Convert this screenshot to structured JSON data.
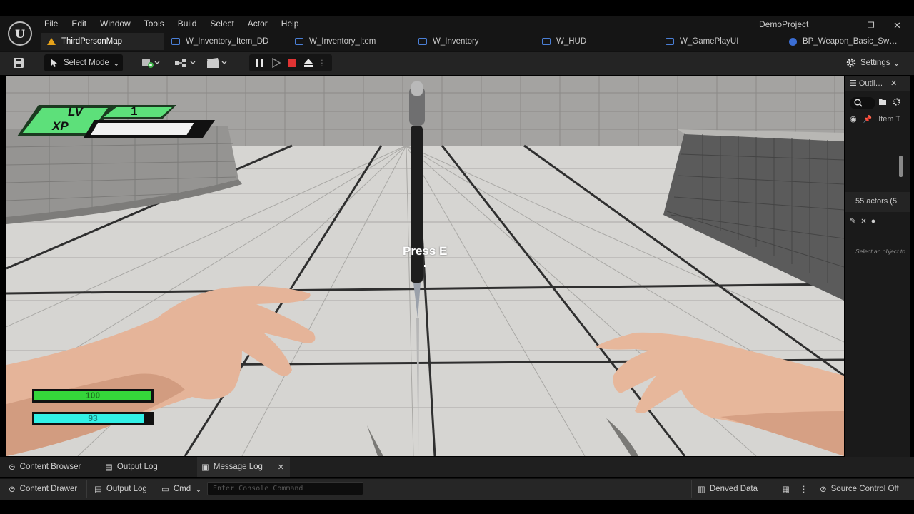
{
  "menu": [
    "File",
    "Edit",
    "Window",
    "Tools",
    "Build",
    "Select",
    "Actor",
    "Help"
  ],
  "project_name": "DemoProject",
  "window_controls": {
    "minimize": "–",
    "restore": "❐",
    "close": "✕"
  },
  "tabs": [
    {
      "label": "ThirdPersonMap",
      "icon": "map-warning-icon"
    },
    {
      "label": "W_Inventory_Item_DD",
      "icon": "widget-blueprint-icon"
    },
    {
      "label": "W_Inventory_Item",
      "icon": "widget-blueprint-icon"
    },
    {
      "label": "W_Inventory",
      "icon": "widget-blueprint-icon"
    },
    {
      "label": "W_HUD",
      "icon": "widget-blueprint-icon"
    },
    {
      "label": "W_GamePlayUI",
      "icon": "widget-blueprint-icon"
    },
    {
      "label": "BP_Weapon_Basic_Sw…",
      "icon": "blueprint-icon"
    }
  ],
  "toolbar": {
    "select_mode": "Select Mode",
    "settings": "Settings"
  },
  "hud": {
    "lv_label": "LV",
    "lv_value": "1",
    "xp_label": "XP",
    "xp_progress": 0.82,
    "health_value": "100",
    "health_progress": 1.0,
    "stamina_value": "93",
    "stamina_progress": 0.93,
    "prompt": "Press E"
  },
  "outliner": {
    "title": "Outli…",
    "item": "Item T",
    "actor_count": "55 actors (5",
    "details_hint": "Select an object to"
  },
  "bottom_tabs": {
    "content_browser": "Content Browser",
    "output_log": "Output Log",
    "message_log": "Message Log"
  },
  "status": {
    "content_drawer": "Content Drawer",
    "output_log": "Output Log",
    "cmd": "Cmd",
    "console_placeholder": "Enter Console Command",
    "derived_data": "Derived Data",
    "source_control": "Source Control Off"
  },
  "colors": {
    "health": "#35d63a",
    "stamina": "#32f0e6",
    "level_badge": "#5de07a",
    "stop": "#e03333",
    "accent": "#3b6ed4"
  }
}
